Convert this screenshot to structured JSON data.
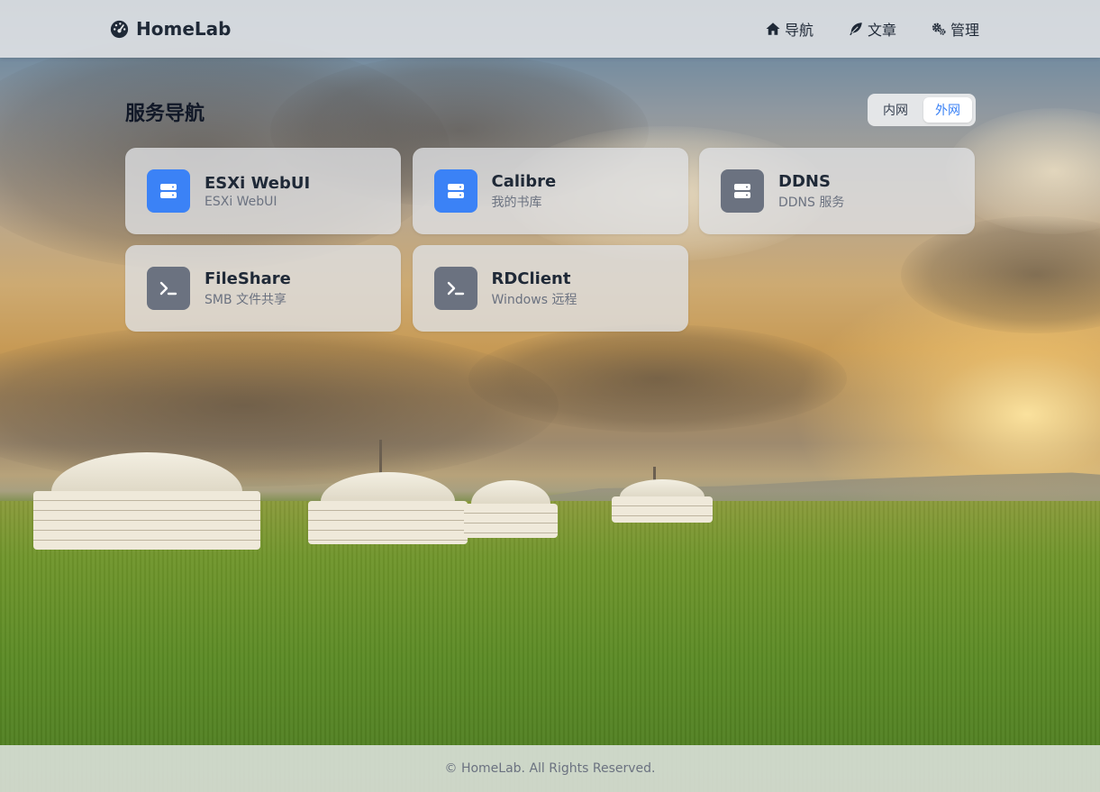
{
  "brand": {
    "name": "HomeLab"
  },
  "nav": {
    "items": [
      {
        "label": "导航",
        "icon": "home-icon"
      },
      {
        "label": "文章",
        "icon": "feather-icon"
      },
      {
        "label": "管理",
        "icon": "gears-icon"
      }
    ]
  },
  "main": {
    "title": "服务导航",
    "network_toggle": {
      "options": [
        "内网",
        "外网"
      ],
      "selected": "外网"
    },
    "services": [
      {
        "name": "ESXi WebUI",
        "desc": "ESXi WebUI",
        "icon": "server-icon",
        "color": "#3b82f6"
      },
      {
        "name": "Calibre",
        "desc": "我的书库",
        "icon": "server-icon",
        "color": "#3b82f6"
      },
      {
        "name": "DDNS",
        "desc": "DDNS 服务",
        "icon": "server-icon",
        "color": "#6b7280"
      },
      {
        "name": "FileShare",
        "desc": "SMB 文件共享",
        "icon": "terminal-icon",
        "color": "#6b7280"
      },
      {
        "name": "RDClient",
        "desc": "Windows 远程",
        "icon": "terminal-icon",
        "color": "#6b7280"
      }
    ]
  },
  "footer": {
    "text": "© HomeLab. All Rights Reserved."
  }
}
